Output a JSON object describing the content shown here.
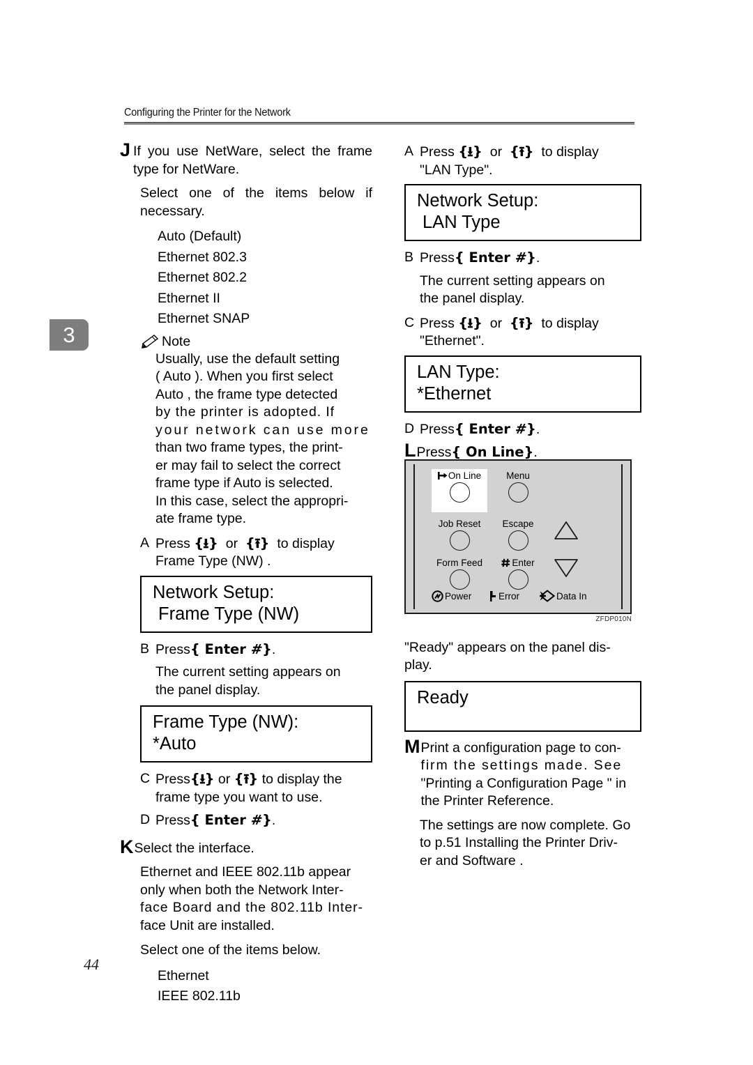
{
  "header": {
    "title": "Configuring the Printer for the Network"
  },
  "chapter_tab": "3",
  "page_number": "44",
  "left_column": {
    "step_j": {
      "marker": "J",
      "text": "If you use NetWare, select the frame type for NetWare."
    },
    "select_items_note": "Select one of the items below if necessary.",
    "frame_type_options": [
      "Auto (Default)",
      "Ethernet 802.3",
      "Ethernet 802.2",
      "Ethernet II",
      "Ethernet SNAP"
    ],
    "note": {
      "icon": "pencil-icon",
      "label": "Note",
      "line1": "Usually, use the default setting",
      "line2": "(  Auto  ). When you first select",
      "line3": "  Auto   , the frame type detected",
      "line4": "by the printer is adopted. If",
      "line5": "your network can use more",
      "line6": "than two frame types, the print-",
      "line7": "er may fail to select the correct",
      "line8": "frame type if   Auto   is selected.",
      "line9": "In this case, select the appropri-",
      "line10": "ate frame type."
    },
    "substep_a": {
      "marker": "A",
      "press_label": "Press",
      "down_key": "{U}",
      "or_label": "or",
      "up_key": "{T}",
      "tail": "to display",
      "line2": "Frame Type (NW)  ."
    },
    "lcd_frame_type_menu": {
      "line1": "Network Setup:",
      "line2": "Frame Type (NW)"
    },
    "substep_b": {
      "marker": "B",
      "press_label": "Press",
      "enter_key": "{Enter #}",
      "period": "."
    },
    "substep_b_note_line1": "The current setting appears on",
    "substep_b_note_line2": "the panel display.",
    "lcd_frame_type_value": {
      "line1": "Frame Type (NW):",
      "line2": "*Auto"
    },
    "substep_c": {
      "marker": "C",
      "press_label": "Press",
      "down_key": "{U}",
      "or_label": "or",
      "up_key": "{T}",
      "tail": "to display the",
      "line2": "frame type you want to use."
    },
    "substep_d": {
      "marker": "D",
      "press_label": "Press",
      "enter_key": "{Enter #}",
      "period": "."
    },
    "step_k": {
      "marker": "K",
      "text": "Select the interface."
    },
    "interface_note_line1": "Ethernet and IEEE 802.11b appear",
    "interface_note_line2": "only when both the Network Inter-",
    "interface_note_line3": "face Board and the 802.11b Inter-",
    "interface_note_line4": "face Unit are installed.",
    "select_items_below": "Select one of the items below.",
    "interface_options": [
      "Ethernet",
      "IEEE 802.11b"
    ]
  },
  "right_column": {
    "substep_a": {
      "marker": "A",
      "press_label": "Press",
      "down_key": "{U}",
      "or_label": "or",
      "up_key": "{T}",
      "tail": "to display",
      "line2": "\"LAN Type\"."
    },
    "lcd_lan_type_menu": {
      "line1": "Network Setup:",
      "line2": "LAN Type"
    },
    "substep_b": {
      "marker": "B",
      "press_label": "Press",
      "enter_key": "{Enter #}",
      "period": "."
    },
    "substep_b_note_line1": "The current setting appears on",
    "substep_b_note_line2": "the panel display.",
    "substep_c": {
      "marker": "C",
      "press_label": "Press",
      "down_key": "{U}",
      "or_label": "or",
      "up_key": "{T}",
      "tail": "to display",
      "line2": "\"Ethernet\"."
    },
    "lcd_lan_type_value": {
      "line1": "LAN Type:",
      "line2": "*Ethernet"
    },
    "substep_d": {
      "marker": "D",
      "press_label": "Press",
      "enter_key": "{Enter #}",
      "period": "."
    },
    "step_l": {
      "marker": "L",
      "press_label": "Press",
      "online_key": "{On Line}",
      "period": "."
    },
    "figure": {
      "caption": "ZFDP010N",
      "buttons": [
        {
          "label": "On Line",
          "icon": "online-arrow-icon",
          "highlighted": true
        },
        {
          "label": "Menu",
          "icon": "",
          "highlighted": false
        },
        {
          "label": "Job Reset",
          "icon": "",
          "highlighted": false
        },
        {
          "label": "Escape",
          "icon": "",
          "highlighted": false
        },
        {
          "label": "Form Feed",
          "icon": "",
          "highlighted": false
        },
        {
          "label": "Enter",
          "icon": "hash-icon",
          "highlighted": false
        }
      ],
      "arrow_keys": [
        {
          "name": "up-arrow-key"
        },
        {
          "name": "down-arrow-key"
        }
      ],
      "indicators": [
        {
          "label": "Power",
          "icon": "power-icon"
        },
        {
          "label": "Error",
          "icon": "error-icon"
        },
        {
          "label": "Data In",
          "icon": "data-in-icon"
        }
      ]
    },
    "ready_note_line1": "\"Ready\" appears on the panel dis-",
    "ready_note_line2": "play.",
    "lcd_ready": {
      "line1": "Ready"
    },
    "step_m": {
      "marker": "M",
      "line1": "Print a configuration page to con-",
      "line2": "firm the settings made. See",
      "line3": "\"Printing a Configuration Page \" in",
      "line4": "the Printer Reference."
    },
    "closing_line1": "The settings are now complete. Go",
    "closing_line2": "to p.51  Installing the Printer Driv-",
    "closing_line3": "er and Software  ."
  }
}
